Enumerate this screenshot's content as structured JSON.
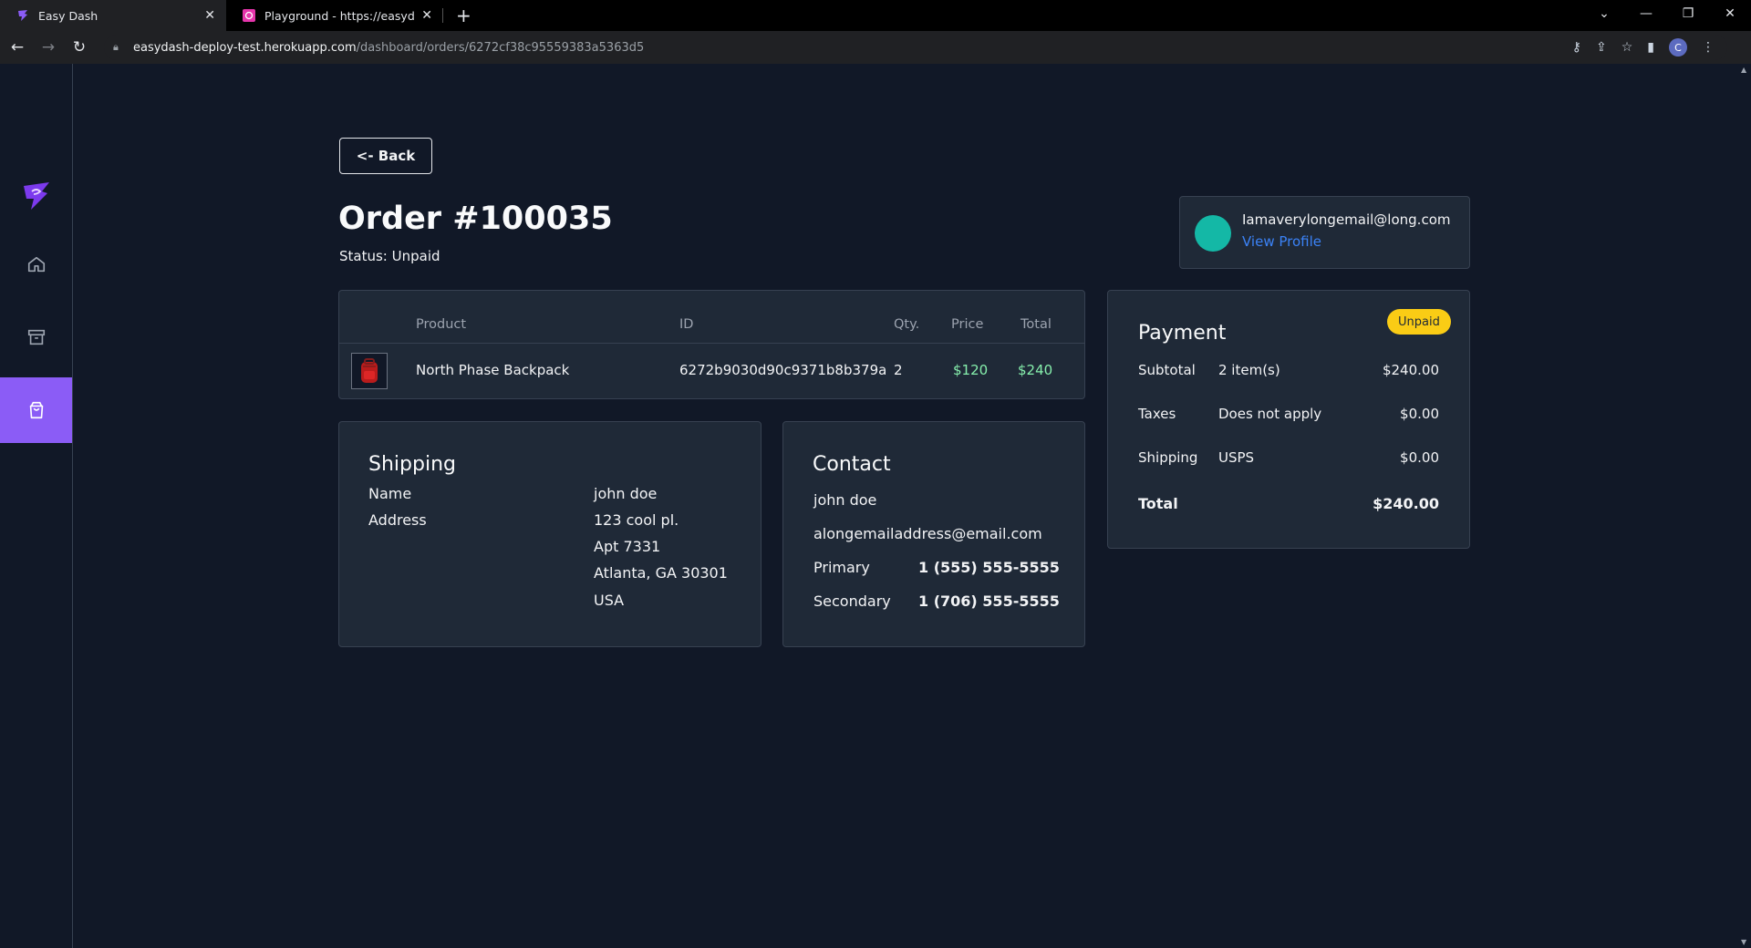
{
  "browser": {
    "tabs": [
      {
        "title": "Easy Dash",
        "active": true
      },
      {
        "title": "Playground - https://easydash-d",
        "active": false
      }
    ],
    "url_host": "easydash-deploy-test.herokuapp.com",
    "url_path": "/dashboard/orders/6272cf38c95559383a5363d5",
    "profile_initial": "C"
  },
  "nav": {
    "back_label": "<- Back"
  },
  "order": {
    "title": "Order #100035",
    "status": "Status: Unpaid"
  },
  "customer": {
    "email": "Iamaverylongemail@long.com",
    "view_profile": "View Profile"
  },
  "items_table": {
    "headers": {
      "product": "Product",
      "id": "ID",
      "qty": "Qty.",
      "price": "Price",
      "total": "Total"
    },
    "rows": [
      {
        "product": "North Phase Backpack",
        "id": "6272b9030d90c9371b8b379a",
        "qty": "2",
        "price": "$120",
        "total": "$240"
      }
    ]
  },
  "payment": {
    "title": "Payment",
    "badge": "Unpaid",
    "rows": [
      {
        "label": "Subtotal",
        "detail": "2 item(s)",
        "amount": "$240.00"
      },
      {
        "label": "Taxes",
        "detail": "Does not apply",
        "amount": "$0.00"
      },
      {
        "label": "Shipping",
        "detail": "USPS",
        "amount": "$0.00"
      }
    ],
    "total_label": "Total",
    "total_amount": "$240.00"
  },
  "shipping": {
    "title": "Shipping",
    "name_label": "Name",
    "name_value": "john doe",
    "address_label": "Address",
    "address_lines": [
      "123 cool pl.",
      "Apt 7331",
      "Atlanta, GA 30301",
      "USA"
    ]
  },
  "contact": {
    "title": "Contact",
    "name": "john doe",
    "email": "alongemailaddress@email.com",
    "primary_label": "Primary",
    "primary_phone": "1 (555) 555-5555",
    "secondary_label": "Secondary",
    "secondary_phone": "1 (706) 555-5555"
  },
  "colors": {
    "background": "#111827",
    "card": "#1f2937",
    "accent": "#8b5cf6",
    "link": "#3b82f6",
    "money": "#86efac",
    "badge": "#facc15"
  }
}
